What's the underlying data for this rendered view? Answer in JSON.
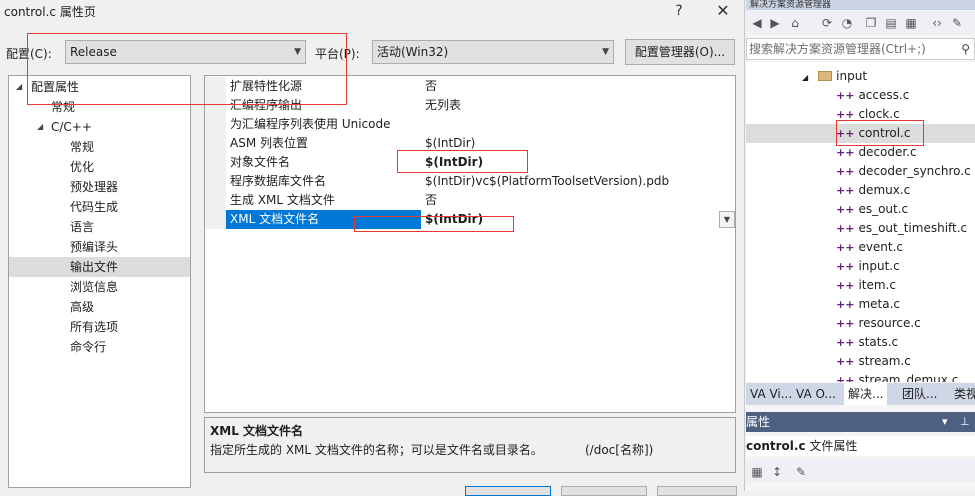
{
  "dialog": {
    "title": "control.c 属性页",
    "help": "?",
    "close": "✕",
    "config_label": "配置(C):",
    "config_value": "Release",
    "platform_label": "平台(P):",
    "platform_value": "活动(Win32)",
    "config_manager": "配置管理器(O)..."
  },
  "tree": {
    "root": "配置属性",
    "items": [
      {
        "label": "常规"
      },
      {
        "label": "C/C++"
      },
      {
        "label": "常规"
      },
      {
        "label": "优化"
      },
      {
        "label": "预处理器"
      },
      {
        "label": "代码生成"
      },
      {
        "label": "语言"
      },
      {
        "label": "预编译头"
      },
      {
        "label": "输出文件"
      },
      {
        "label": "浏览信息"
      },
      {
        "label": "高级"
      },
      {
        "label": "所有选项"
      },
      {
        "label": "命令行"
      }
    ]
  },
  "grid": {
    "rows": [
      {
        "name": "扩展特性化源",
        "value": "否"
      },
      {
        "name": "汇编程序输出",
        "value": "无列表"
      },
      {
        "name": "为汇编程序列表使用 Unicode",
        "value": ""
      },
      {
        "name": "ASM 列表位置",
        "value": "$(IntDir)"
      },
      {
        "name": "对象文件名",
        "value": "$(IntDir)"
      },
      {
        "name": "程序数据库文件名",
        "value": "$(IntDir)vc$(PlatformToolsetVersion).pdb"
      },
      {
        "name": "生成 XML 文档文件",
        "value": "否"
      },
      {
        "name": "XML 文档文件名",
        "value": "$(IntDir)"
      }
    ]
  },
  "description": {
    "title": "XML 文档文件名",
    "text": "指定所生成的 XML 文档文件的名称；可以是文件名或目录名。",
    "switch": "(/doc[名称])"
  },
  "solution": {
    "title_bar": "解决方案资源管理器",
    "search_placeholder": "搜索解决方案资源管理器(Ctrl+;)",
    "folder": "input",
    "files": [
      "access.c",
      "clock.c",
      "control.c",
      "decoder.c",
      "decoder_synchro.c",
      "demux.c",
      "es_out.c",
      "es_out_timeshift.c",
      "event.c",
      "input.c",
      "item.c",
      "meta.c",
      "resource.c",
      "stats.c",
      "stream.c",
      "stream_demux.c"
    ],
    "tabs": [
      "VA Vi...",
      "VA O...",
      "解决...",
      "团队...",
      "类视"
    ],
    "props_title": "属性",
    "props_object": "control.c",
    "props_object_type": "文件属性"
  }
}
